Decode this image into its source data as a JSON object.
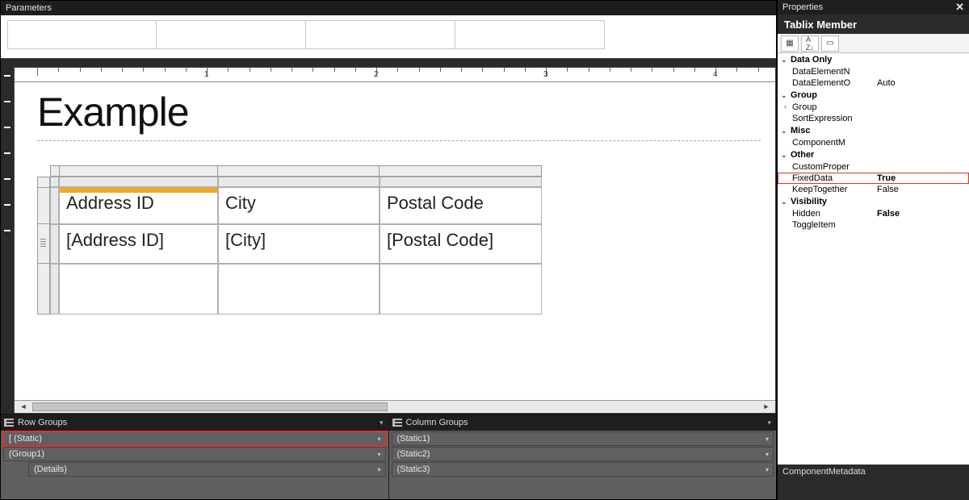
{
  "parameters_label": "Parameters",
  "report_title": "Example",
  "ruler_numbers": [
    "1",
    "2",
    "3",
    "4"
  ],
  "tablix": {
    "headers": [
      "Address ID",
      "City",
      "Postal Code"
    ],
    "data_row": [
      "[Address ID]",
      "[City]",
      "[Postal Code]"
    ]
  },
  "row_groups": {
    "title": "Row Groups",
    "items": [
      {
        "label": "[ (Static)",
        "indent": 0,
        "selected": true
      },
      {
        "label": "(Group1)",
        "indent": 0,
        "selected": false
      },
      {
        "label": "(Details)",
        "indent": 2,
        "selected": false
      }
    ]
  },
  "column_groups": {
    "title": "Column Groups",
    "items": [
      {
        "label": "(Static1)",
        "indent": 0
      },
      {
        "label": "(Static2)",
        "indent": 0
      },
      {
        "label": "(Static3)",
        "indent": 0
      }
    ]
  },
  "properties": {
    "panel_title": "Properties",
    "object_title": "Tablix Member",
    "footer": "ComponentMetadata",
    "categories": [
      {
        "name": "Data Only",
        "expanded": true,
        "props": [
          {
            "name": "DataElementN",
            "value": ""
          },
          {
            "name": "DataElementO",
            "value": "Auto"
          }
        ]
      },
      {
        "name": "Group",
        "expanded": true,
        "props": [
          {
            "name": "Group",
            "value": "",
            "expandable": true
          },
          {
            "name": "SortExpression",
            "value": ""
          }
        ]
      },
      {
        "name": "Misc",
        "expanded": true,
        "props": [
          {
            "name": "ComponentM",
            "value": ""
          }
        ]
      },
      {
        "name": "Other",
        "expanded": true,
        "props": [
          {
            "name": "CustomProper",
            "value": ""
          },
          {
            "name": "FixedData",
            "value": "True",
            "bold": true,
            "highlight": true
          },
          {
            "name": "KeepTogether",
            "value": "False"
          }
        ]
      },
      {
        "name": "Visibility",
        "expanded": true,
        "props": [
          {
            "name": "Hidden",
            "value": "False",
            "bold": true
          },
          {
            "name": "ToggleItem",
            "value": ""
          }
        ]
      }
    ]
  }
}
